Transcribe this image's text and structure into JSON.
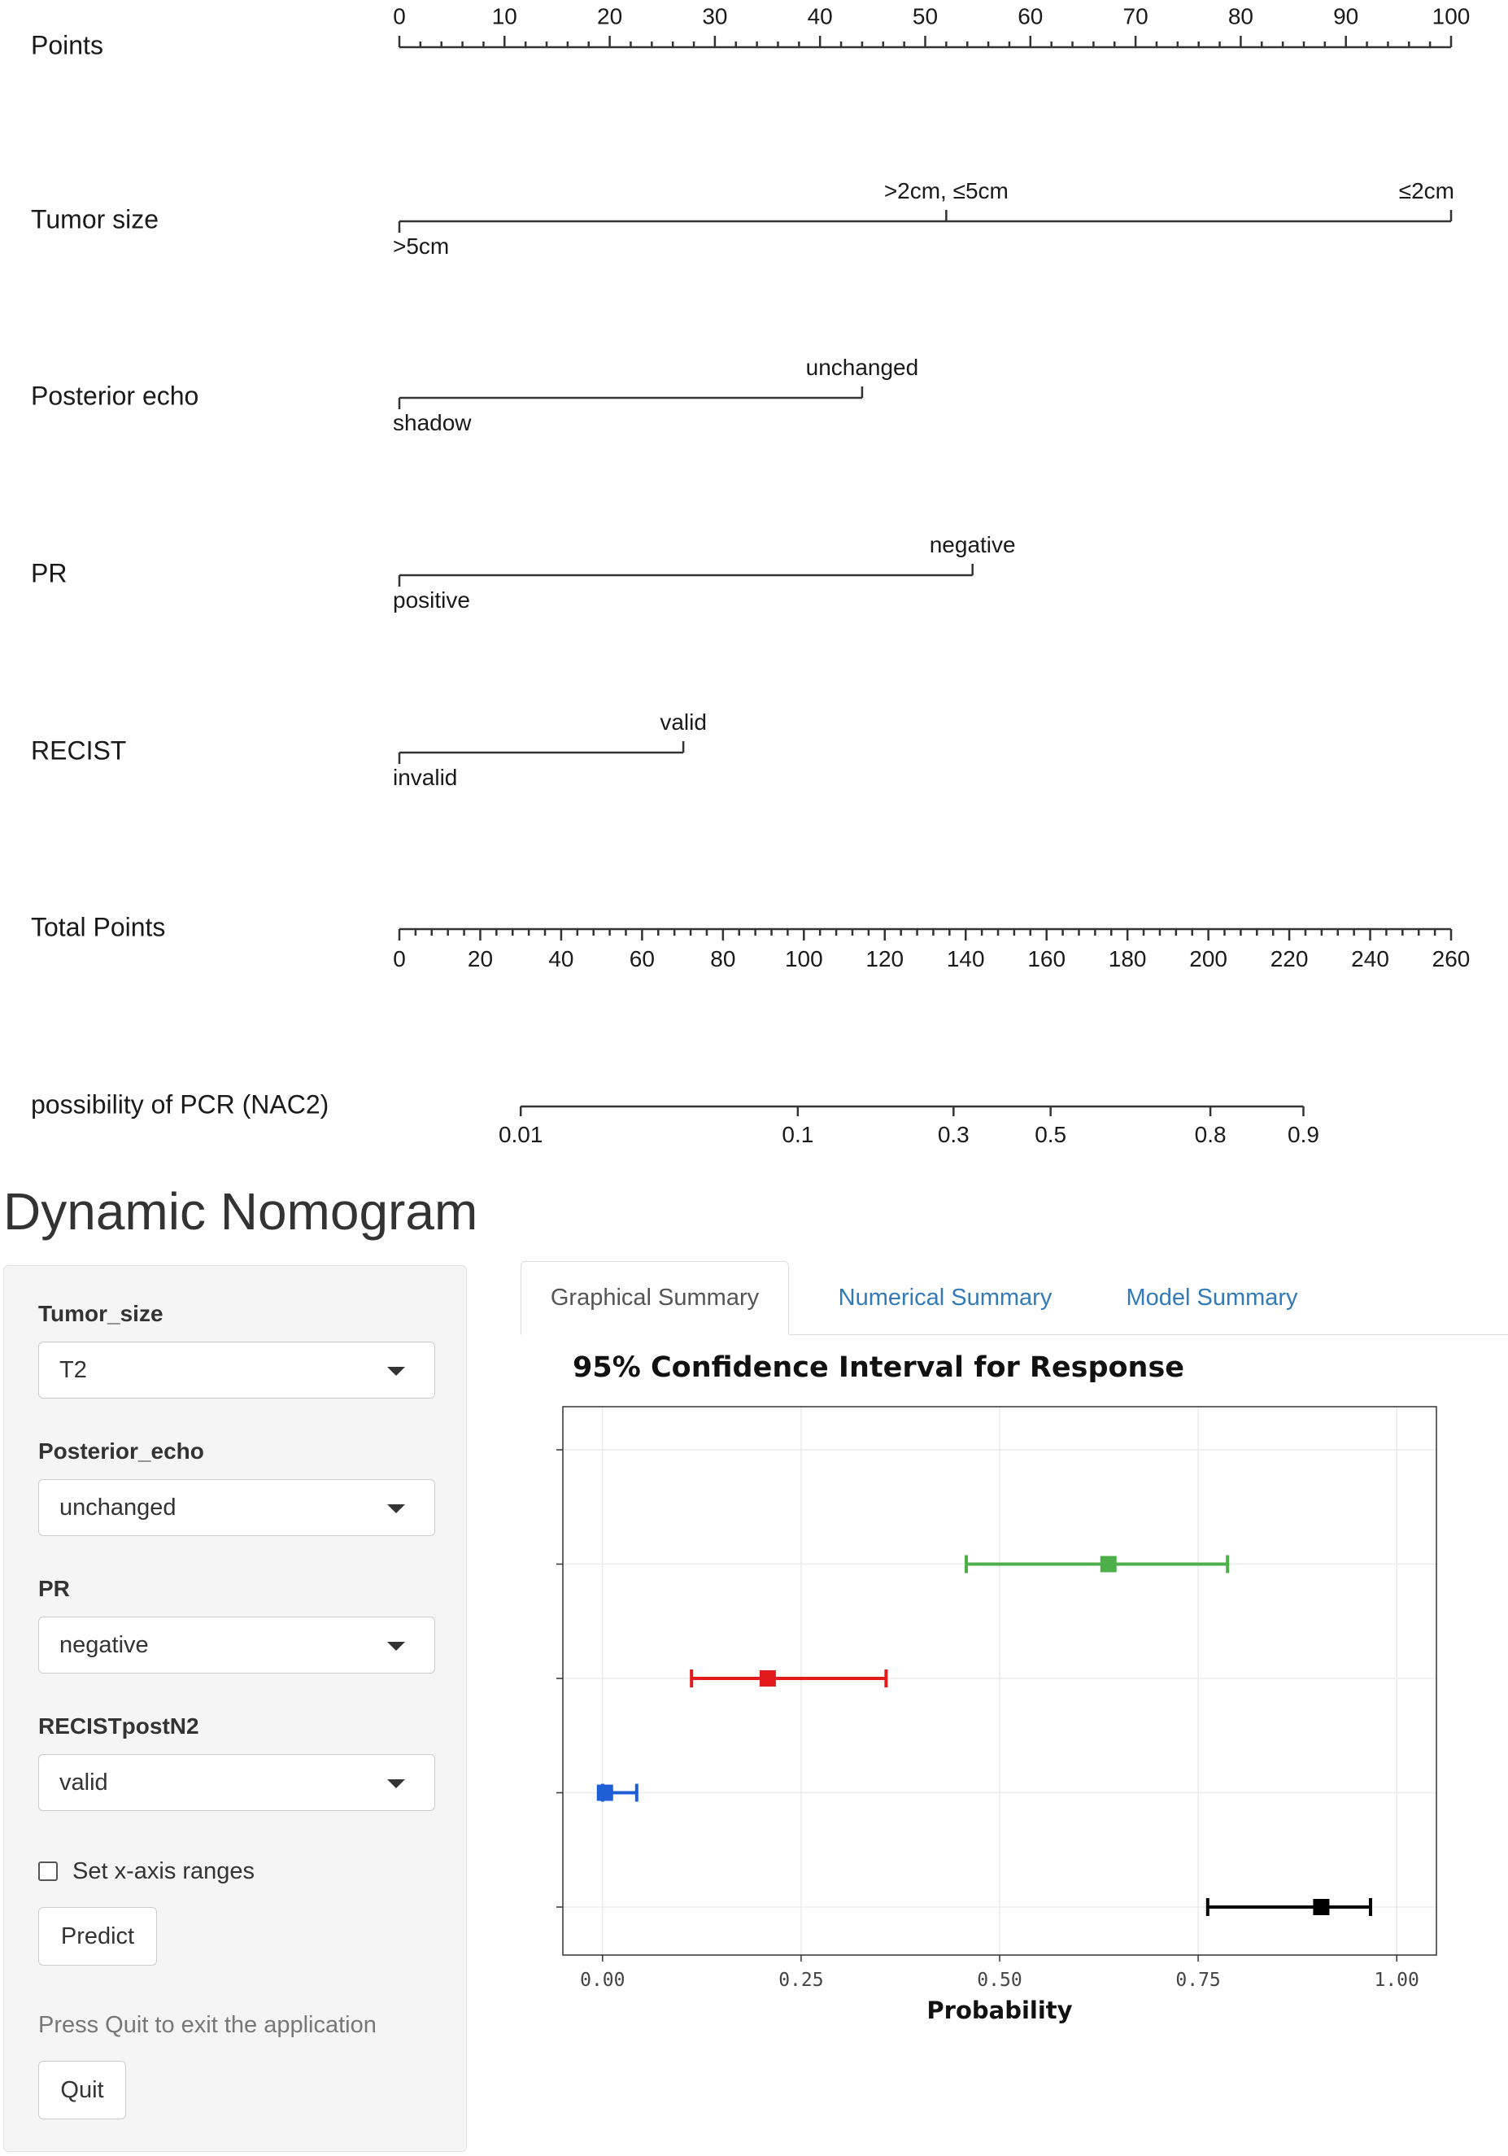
{
  "nomogram": {
    "points": {
      "label": "Points",
      "ticks": [
        "0",
        "10",
        "20",
        "30",
        "40",
        "50",
        "60",
        "70",
        "80",
        "90",
        "100"
      ]
    },
    "variables": [
      {
        "label": "Tumor size",
        "levels": [
          {
            "text": ">5cm",
            "points": 0,
            "side": "below"
          },
          {
            "text": ">2cm, ≤5cm",
            "points": 52,
            "side": "above"
          },
          {
            "text": "≤2cm",
            "points": 100,
            "side": "above"
          }
        ]
      },
      {
        "label": "Posterior echo",
        "levels": [
          {
            "text": "shadow",
            "points": 0,
            "side": "below"
          },
          {
            "text": "unchanged",
            "points": 44,
            "side": "above"
          }
        ]
      },
      {
        "label": "PR",
        "levels": [
          {
            "text": "positive",
            "points": 0,
            "side": "below"
          },
          {
            "text": "negative",
            "points": 54.5,
            "side": "above"
          }
        ]
      },
      {
        "label": "RECIST",
        "levels": [
          {
            "text": "invalid",
            "points": 0,
            "side": "below"
          },
          {
            "text": "valid",
            "points": 27,
            "side": "above"
          }
        ]
      }
    ],
    "total_points": {
      "label": "Total Points",
      "ticks": [
        "0",
        "20",
        "40",
        "60",
        "80",
        "100",
        "120",
        "140",
        "160",
        "180",
        "200",
        "220",
        "240",
        "260"
      ]
    },
    "probability": {
      "label": "possibility of PCR (NAC2)",
      "ticks": [
        {
          "text": "0.01",
          "total_points": 30
        },
        {
          "text": "0.1",
          "total_points": 98.5
        },
        {
          "text": "0.3",
          "total_points": 137
        },
        {
          "text": "0.5",
          "total_points": 161
        },
        {
          "text": "0.8",
          "total_points": 200.5
        },
        {
          "text": "0.9",
          "total_points": 223.5
        }
      ]
    }
  },
  "app": {
    "title": "Dynamic Nomogram",
    "sidebar": {
      "fields": [
        {
          "label": "Tumor_size",
          "value": "T2"
        },
        {
          "label": "Posterior_echo",
          "value": "unchanged"
        },
        {
          "label": "PR",
          "value": "negative"
        },
        {
          "label": "RECISTpostN2",
          "value": "valid"
        }
      ],
      "xrange_label": "Set x-axis ranges",
      "xrange_checked": false,
      "predict_label": "Predict",
      "quit_hint": "Press Quit to exit the application",
      "quit_label": "Quit"
    },
    "tabs": [
      {
        "label": "Graphical Summary",
        "active": true
      },
      {
        "label": "Numerical Summary",
        "active": false
      },
      {
        "label": "Model Summary",
        "active": false
      }
    ]
  },
  "chart_data": {
    "type": "scatter",
    "title": "95% Confidence Interval for Response",
    "xlabel": "Probability",
    "ylabel": "",
    "xlim": [
      -0.05,
      1.05
    ],
    "x_ticks": [
      "0.00",
      "0.25",
      "0.50",
      "0.75",
      "1.00"
    ],
    "x_tick_values": [
      0,
      0.25,
      0.5,
      0.75,
      1.0
    ],
    "y_slots": 5,
    "grid": true,
    "series": [
      {
        "color": "#000000",
        "slot": 1,
        "estimate": 0.905,
        "lower": 0.762,
        "upper": 0.967
      },
      {
        "color": "#1f5fd6",
        "slot": 2,
        "estimate": 0.003,
        "lower": 0.0,
        "upper": 0.043
      },
      {
        "color": "#e31a1c",
        "slot": 3,
        "estimate": 0.208,
        "lower": 0.112,
        "upper": 0.357
      },
      {
        "color": "#4daf4a",
        "slot": 4,
        "estimate": 0.637,
        "lower": 0.458,
        "upper": 0.787
      }
    ]
  }
}
